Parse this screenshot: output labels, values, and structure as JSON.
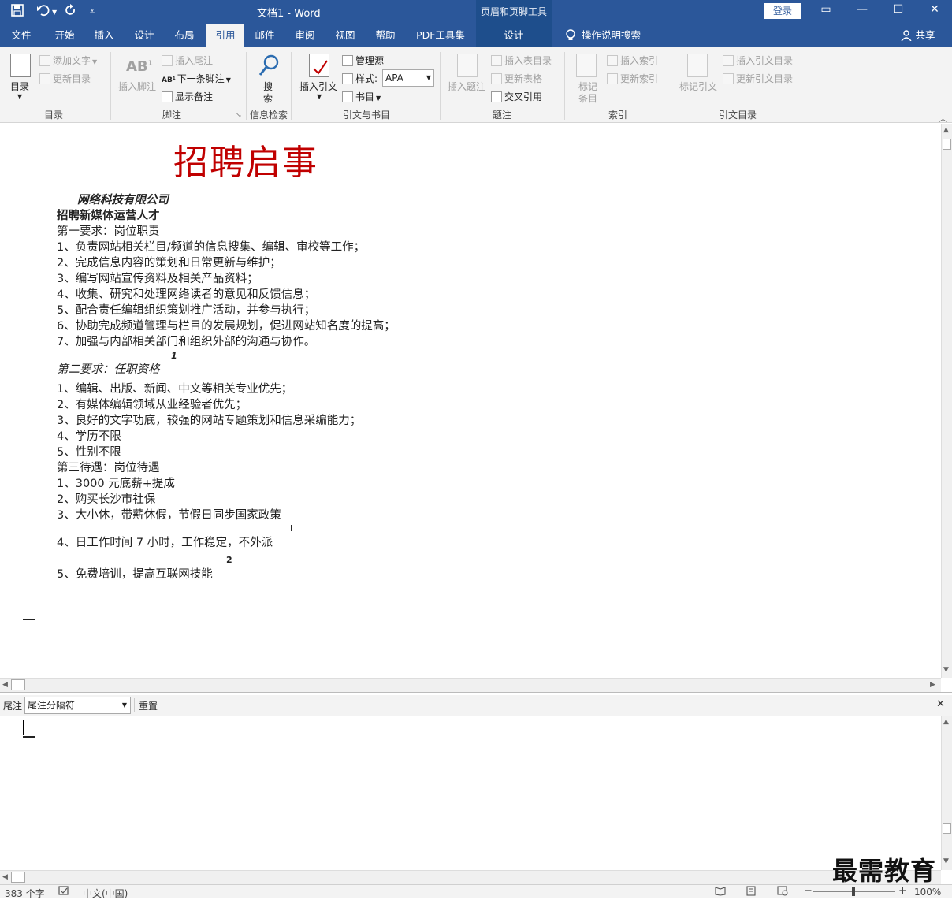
{
  "titlebar": {
    "doc_title": "文档1  -  Word",
    "context_tools_title": "页眉和页脚工具",
    "login_label": "登录",
    "save_icon": "save-icon",
    "undo_icon": "undo-icon",
    "redo_icon": "redo-icon",
    "customize_icon": "customize-qat-icon"
  },
  "tabs": {
    "file": "文件",
    "home": "开始",
    "insert": "插入",
    "design": "设计",
    "layout": "布局",
    "references": "引用",
    "mailings": "邮件",
    "review": "审阅",
    "view": "视图",
    "help": "帮助",
    "pdf": "PDF工具集",
    "hf_design": "设计",
    "tell_me": "操作说明搜索",
    "share": "共享"
  },
  "ribbon": {
    "toc": {
      "button": "目录",
      "add_text": "添加文字",
      "update_table": "更新目录",
      "label": "目录"
    },
    "footnotes": {
      "insert_footnote": "插入脚注",
      "insert_endnote": "插入尾注",
      "next_footnote": "下一条脚注",
      "show_notes": "显示备注",
      "label": "脚注"
    },
    "research": {
      "search_line1": "搜",
      "search_line2": "索",
      "label": "信息检索"
    },
    "citations": {
      "insert_citation": "插入引文",
      "manage_sources": "管理源",
      "style_label": "样式:",
      "style_value": "APA",
      "bibliography": "书目",
      "label": "引文与书目"
    },
    "captions": {
      "insert_caption": "插入题注",
      "insert_tof": "插入表目录",
      "update_table": "更新表格",
      "cross_ref": "交叉引用",
      "label": "题注"
    },
    "index": {
      "mark_entry_1": "标记",
      "mark_entry_2": "条目",
      "insert_index": "插入索引",
      "update_index": "更新索引",
      "label": "索引"
    },
    "toa": {
      "mark_citation": "标记引文",
      "insert_toa": "插入引文目录",
      "update_toa": "更新引文目录",
      "label": "引文目录"
    }
  },
  "document": {
    "heading": "招聘启事",
    "company": "网络科技有限公司",
    "position": "招聘新媒体运营人才",
    "req1_title": "第一要求：岗位职责",
    "req1_items": [
      "1、负责网站相关栏目/频道的信息搜集、编辑、审校等工作；",
      "2、完成信息内容的策划和日常更新与维护；",
      "3、编写网站宣传资料及相关产品资料；",
      "4、收集、研究和处理网络读者的意见和反馈信息；",
      "5、配合责任编辑组织策划推广活动，并参与执行；",
      "6、协助完成频道管理与栏目的发展规划，促进网站知名度的提高；",
      "7、加强与内部相关部门和组织外部的沟通与协作。"
    ],
    "req2_title": "第二要求：任职资格",
    "req2_footnote_mark": "1",
    "req2_items": [
      "1、编辑、出版、新闻、中文等相关专业优先；",
      "2、有媒体编辑领域从业经验者优先；",
      "3、良好的文字功底，较强的网站专题策划和信息采编能力；",
      "4、学历不限",
      "5、性别不限"
    ],
    "benefit_title": "第三待遇：岗位待遇",
    "benefit_items": [
      "1、3000 元底薪+提成",
      "2、购买长沙市社保",
      "3、大小休，带薪休假，节假日同步国家政策"
    ],
    "benefit_item4": "4、日工作时间 7 小时，工作稳定，不外派",
    "benefit_item4_mark": "i",
    "benefit_item5": "5、免费培训，提高互联网技能",
    "benefit_item5_mark": "2"
  },
  "notes_pane": {
    "label": "尾注",
    "dropdown_value": "尾注分隔符",
    "reset": "重置",
    "close_icon": "close-icon"
  },
  "statusbar": {
    "word_count": "383 个字",
    "language": "中文(中国)",
    "zoom": "100%"
  },
  "watermark": "最需教育"
}
